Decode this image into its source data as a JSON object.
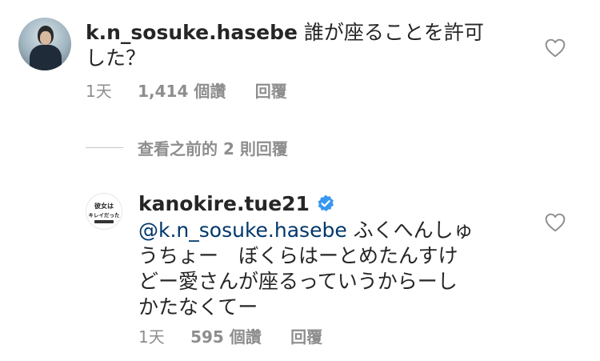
{
  "comment1": {
    "username": "k.n_sosuke.hasebe",
    "text_line1": "誰が座ることを許可",
    "text_line2": "した？",
    "time": "1天",
    "likes": "1,414 個讚",
    "reply": "回覆"
  },
  "view_replies": {
    "label": "查看之前的 2 則回覆"
  },
  "comment2": {
    "username": "kanokire.tue21",
    "mention": "@k.n_sosuke.hasebe",
    "text_line1": " ふくへんしゅ",
    "text_line2": "うちょー　ぼくらはーとめたんすけ",
    "text_line3": "どー愛さんが座るっていうからーし",
    "text_line4": "かたなくてー",
    "time": "1天",
    "likes": "595 個讚",
    "reply": "回覆",
    "avatar_text": [
      "彼女は",
      "キレイだった"
    ]
  },
  "colors": {
    "text": "#262626",
    "muted": "#8e8e8e",
    "mention": "#00376b",
    "verified": "#3897f0"
  },
  "icons": {
    "heart": "heart-outline-icon",
    "verified": "verified-badge-icon"
  }
}
